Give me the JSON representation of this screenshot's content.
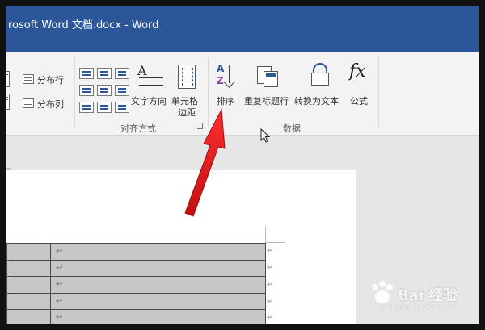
{
  "window": {
    "title": "rosoft Word 文档.docx - Word"
  },
  "ribbon": {
    "rows_cols": {
      "distribute_rows": "分布行",
      "distribute_cols": "分布列"
    },
    "alignment": {
      "text_direction": "文字方向",
      "cell_margins_line1": "单元格",
      "cell_margins_line2": "边距",
      "group_label": "对齐方式"
    },
    "data": {
      "sort": "排序",
      "repeat_header": "重复标题行",
      "convert_to_text": "转换为文本",
      "formula": "公式",
      "formula_glyph": "fx",
      "group_label": "数据"
    }
  },
  "document": {
    "cell_mark": "↩",
    "rows": 5
  },
  "colors": {
    "title_bar": "#2b579a",
    "annotation_arrow": "#e81c1c"
  },
  "watermark": {
    "text": "Bai 经验",
    "sub": "jingyan.baidu.com"
  }
}
